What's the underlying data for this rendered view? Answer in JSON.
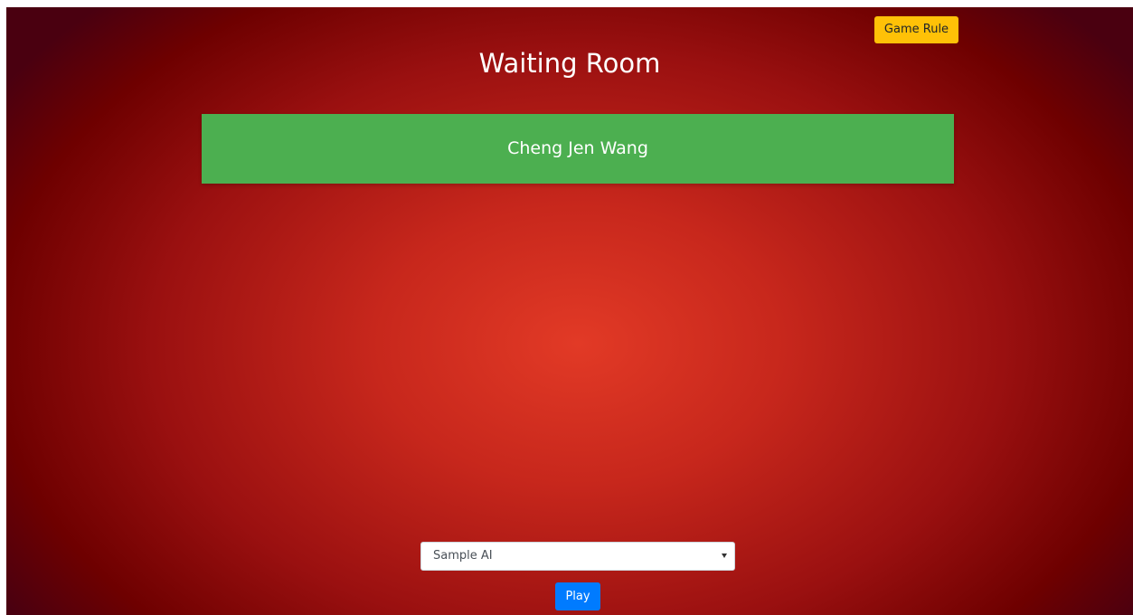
{
  "header": {
    "game_rule_label": "Game Rule",
    "title": "Waiting Room"
  },
  "players": [
    {
      "name": "Cheng Jen Wang"
    }
  ],
  "opponent_select": {
    "selected": "Sample AI"
  },
  "actions": {
    "play_label": "Play"
  },
  "colors": {
    "game_rule_button": "#ffc107",
    "player_card": "#4caf50",
    "play_button": "#007bff",
    "background_center": "#e23a26",
    "background_edge": "#4a0010"
  }
}
